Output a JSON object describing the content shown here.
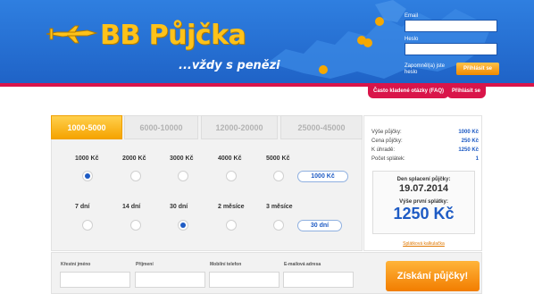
{
  "header": {
    "logo_text": "BB Půjčka",
    "tagline": "...vždy s penězi",
    "login": {
      "email_label": "Email",
      "password_label": "Heslo",
      "forgot_label": "Zapomněl(a) jste heslo",
      "login_button": "Přihlásit se"
    },
    "nav": {
      "faq": "Často kladené otázky (FAQ)",
      "register": "Přihlásit se"
    }
  },
  "loan_tabs": [
    {
      "label": "1000-5000",
      "active": true
    },
    {
      "label": "6000-10000",
      "active": false
    },
    {
      "label": "12000-20000",
      "active": false
    },
    {
      "label": "25000-45000",
      "active": false
    }
  ],
  "amounts": {
    "options": [
      "1000 Kč",
      "2000 Kč",
      "3000 Kč",
      "4000 Kč",
      "5000 Kč"
    ],
    "selected_index": 0,
    "selected_value": "1000 Kč"
  },
  "durations": {
    "options": [
      "7 dní",
      "14 dní",
      "30 dní",
      "2 měsíce",
      "3 měsíce"
    ],
    "selected_index": 2,
    "selected_value": "30 dní"
  },
  "summary": {
    "rows": [
      {
        "key": "Výše půjčky:",
        "value": "1000 Kč"
      },
      {
        "key": "Cena půjčky:",
        "value": "250 Kč"
      },
      {
        "key": "K úhradě:",
        "value": "1250 Kč"
      },
      {
        "key": "Počet splátek:",
        "value": "1"
      }
    ],
    "due_label": "Den splacení půjčky:",
    "due_date": "19.07.2014",
    "first_payment_label": "Výše první splátky:",
    "first_payment": "1250 Kč",
    "calc_link": "Splátková kalkulačka"
  },
  "contact": {
    "first_name": "Křestní jméno",
    "last_name": "Příjmení",
    "phone": "Mobilní telefon",
    "email": "E-mailová adresa",
    "cta": "Získání půjčky!"
  },
  "colors": {
    "header_blue": "#1f63c7",
    "accent_orange": "#f5a300",
    "accent_red": "#d9154a",
    "value_blue": "#1e5bc4"
  }
}
